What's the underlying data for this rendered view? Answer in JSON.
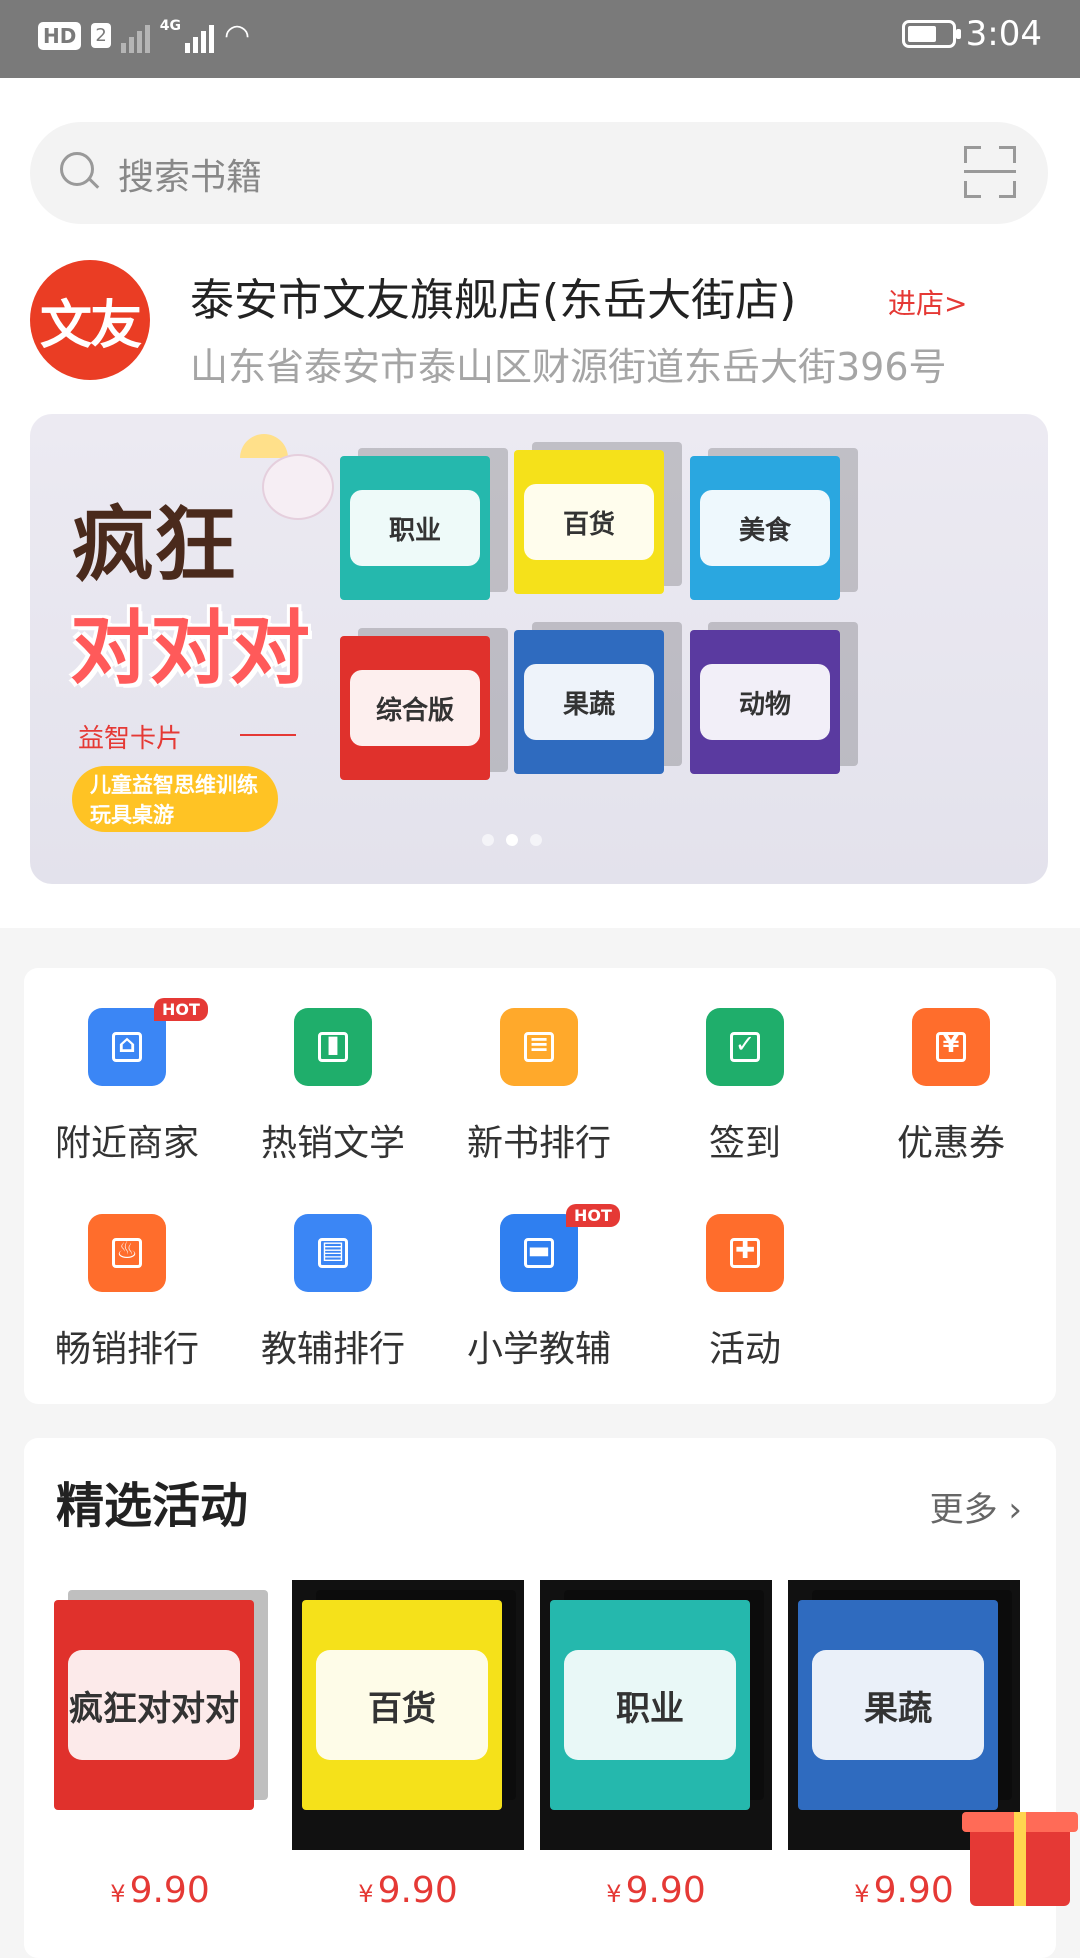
{
  "status_bar": {
    "hd_label": "HD",
    "sim_label": "2",
    "network": "4G",
    "time": "3:04"
  },
  "search": {
    "placeholder": "搜索书籍"
  },
  "shop": {
    "logo_text": "文友",
    "name": "泰安市文友旗舰店(东岳大街店)",
    "enter_label": "进店>",
    "address": "山东省泰安市泰山区财源街道东岳大街396号"
  },
  "banner": {
    "title_line1": "疯狂",
    "title_line2": "对对对",
    "subtitle": "益智卡片",
    "pill": "儿童益智思维训练玩具桌游",
    "box_labels": [
      "职业",
      "百货",
      "美食",
      "综合版",
      "果蔬",
      "动物"
    ],
    "box_colors": [
      "#25b8ad",
      "#f5e11a",
      "#2aa7e0",
      "#e0312c",
      "#2f6bbf",
      "#5a3aa0"
    ],
    "slide_count": 3,
    "active_slide": 2
  },
  "categories": {
    "items": [
      {
        "label": "附近商家",
        "icon": "shop-icon",
        "color": "#3b86f5",
        "hot": true
      },
      {
        "label": "热销文学",
        "icon": "book-icon",
        "color": "#1fae6b",
        "hot": false
      },
      {
        "label": "新书排行",
        "icon": "document-icon",
        "color": "#ffa92b",
        "hot": false
      },
      {
        "label": "签到",
        "icon": "calendar-check-icon",
        "color": "#1fae6b",
        "hot": false
      },
      {
        "label": "优惠券",
        "icon": "coupon-icon",
        "color": "#ff6d2c",
        "hot": false
      },
      {
        "label": "畅销排行",
        "icon": "flame-icon",
        "color": "#ff6d2c",
        "hot": false
      },
      {
        "label": "教辅排行",
        "icon": "textbook-icon",
        "color": "#3b86f5",
        "hot": false
      },
      {
        "label": "小学教辅",
        "icon": "folder-icon",
        "color": "#2f7ff0",
        "hot": true
      },
      {
        "label": "活动",
        "icon": "gift-icon",
        "color": "#ff6d2c",
        "hot": false
      }
    ],
    "hot_badge": "HOT"
  },
  "activities": {
    "title": "精选活动",
    "more_label": "更多",
    "currency": "¥",
    "products": [
      {
        "label": "疯狂对对对",
        "color": "#e0312c",
        "price": "9.90",
        "bg": "#ffffff"
      },
      {
        "label": "百货",
        "color": "#f5e11a",
        "price": "9.90",
        "bg": "#111111"
      },
      {
        "label": "职业",
        "color": "#25b8ad",
        "price": "9.90",
        "bg": "#111111"
      },
      {
        "label": "果蔬",
        "color": "#2f6bbf",
        "price": "9.90",
        "bg": "#111111"
      }
    ]
  }
}
